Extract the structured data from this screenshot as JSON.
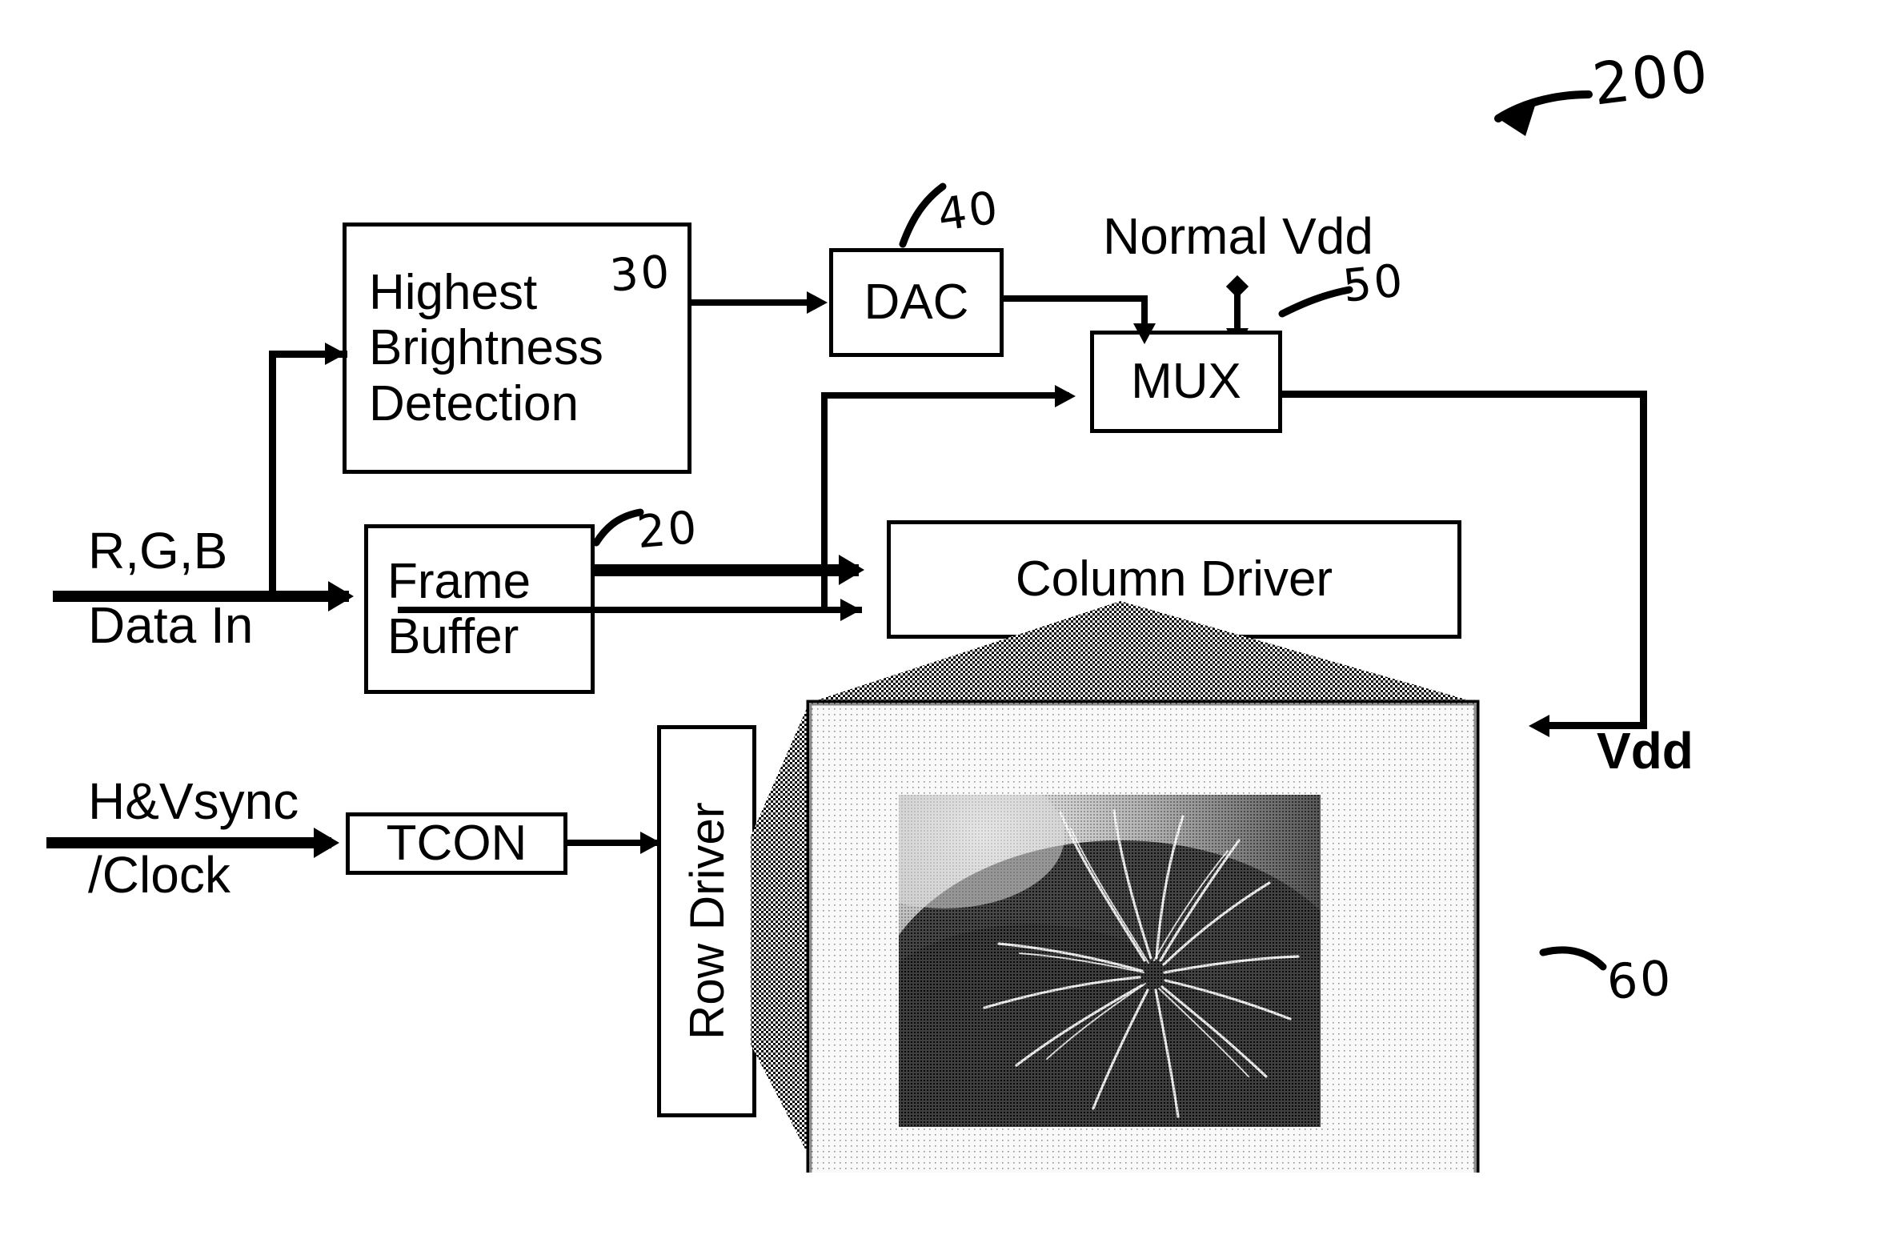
{
  "figure": {
    "reference_numeral": "200",
    "arrow_glyph": "↙"
  },
  "blocks": [
    {
      "id": "highest-brightness-detection",
      "label": "Highest\nBrightness\nDetection",
      "ref": "30"
    },
    {
      "id": "dac",
      "label": "DAC",
      "ref": "40"
    },
    {
      "id": "mux",
      "label": "MUX",
      "ref": "50"
    },
    {
      "id": "frame-buffer",
      "label": "Frame\nBuffer",
      "ref": "20"
    },
    {
      "id": "column-driver",
      "label": "Column Driver",
      "ref": ""
    },
    {
      "id": "row-driver",
      "label": "Row Driver",
      "ref": ""
    },
    {
      "id": "tcon",
      "label": "TCON",
      "ref": ""
    },
    {
      "id": "display-panel",
      "label": "",
      "ref": "60"
    }
  ],
  "signals": {
    "rgb_data_in_line1": "R,G,B",
    "rgb_data_in_line2": "Data In",
    "hv_sync_line1": "H&Vsync",
    "hv_sync_line2": "/Clock",
    "normal_vdd": "Normal Vdd",
    "vdd": "Vdd"
  },
  "refs": {
    "fig": "200",
    "frame_buffer": "20",
    "highest_brightness": "30",
    "dac": "40",
    "mux": "50",
    "display": "60"
  },
  "colors": {
    "ink": "#000000",
    "paper": "#ffffff",
    "panel_bezel_gray": "#6b6b6b",
    "panel_face_light": "#e8e8e8",
    "photo_dark": "#101010"
  }
}
